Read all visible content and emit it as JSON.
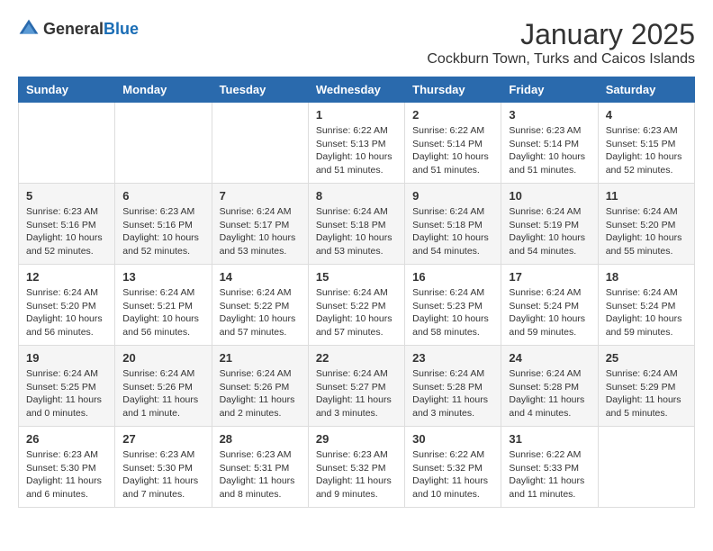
{
  "logo": {
    "general": "General",
    "blue": "Blue"
  },
  "title": "January 2025",
  "subtitle": "Cockburn Town, Turks and Caicos Islands",
  "weekdays": [
    "Sunday",
    "Monday",
    "Tuesday",
    "Wednesday",
    "Thursday",
    "Friday",
    "Saturday"
  ],
  "weeks": [
    [
      {
        "day": "",
        "sunrise": "",
        "sunset": "",
        "daylight": ""
      },
      {
        "day": "",
        "sunrise": "",
        "sunset": "",
        "daylight": ""
      },
      {
        "day": "",
        "sunrise": "",
        "sunset": "",
        "daylight": ""
      },
      {
        "day": "1",
        "sunrise": "Sunrise: 6:22 AM",
        "sunset": "Sunset: 5:13 PM",
        "daylight": "Daylight: 10 hours and 51 minutes."
      },
      {
        "day": "2",
        "sunrise": "Sunrise: 6:22 AM",
        "sunset": "Sunset: 5:14 PM",
        "daylight": "Daylight: 10 hours and 51 minutes."
      },
      {
        "day": "3",
        "sunrise": "Sunrise: 6:23 AM",
        "sunset": "Sunset: 5:14 PM",
        "daylight": "Daylight: 10 hours and 51 minutes."
      },
      {
        "day": "4",
        "sunrise": "Sunrise: 6:23 AM",
        "sunset": "Sunset: 5:15 PM",
        "daylight": "Daylight: 10 hours and 52 minutes."
      }
    ],
    [
      {
        "day": "5",
        "sunrise": "Sunrise: 6:23 AM",
        "sunset": "Sunset: 5:16 PM",
        "daylight": "Daylight: 10 hours and 52 minutes."
      },
      {
        "day": "6",
        "sunrise": "Sunrise: 6:23 AM",
        "sunset": "Sunset: 5:16 PM",
        "daylight": "Daylight: 10 hours and 52 minutes."
      },
      {
        "day": "7",
        "sunrise": "Sunrise: 6:24 AM",
        "sunset": "Sunset: 5:17 PM",
        "daylight": "Daylight: 10 hours and 53 minutes."
      },
      {
        "day": "8",
        "sunrise": "Sunrise: 6:24 AM",
        "sunset": "Sunset: 5:18 PM",
        "daylight": "Daylight: 10 hours and 53 minutes."
      },
      {
        "day": "9",
        "sunrise": "Sunrise: 6:24 AM",
        "sunset": "Sunset: 5:18 PM",
        "daylight": "Daylight: 10 hours and 54 minutes."
      },
      {
        "day": "10",
        "sunrise": "Sunrise: 6:24 AM",
        "sunset": "Sunset: 5:19 PM",
        "daylight": "Daylight: 10 hours and 54 minutes."
      },
      {
        "day": "11",
        "sunrise": "Sunrise: 6:24 AM",
        "sunset": "Sunset: 5:20 PM",
        "daylight": "Daylight: 10 hours and 55 minutes."
      }
    ],
    [
      {
        "day": "12",
        "sunrise": "Sunrise: 6:24 AM",
        "sunset": "Sunset: 5:20 PM",
        "daylight": "Daylight: 10 hours and 56 minutes."
      },
      {
        "day": "13",
        "sunrise": "Sunrise: 6:24 AM",
        "sunset": "Sunset: 5:21 PM",
        "daylight": "Daylight: 10 hours and 56 minutes."
      },
      {
        "day": "14",
        "sunrise": "Sunrise: 6:24 AM",
        "sunset": "Sunset: 5:22 PM",
        "daylight": "Daylight: 10 hours and 57 minutes."
      },
      {
        "day": "15",
        "sunrise": "Sunrise: 6:24 AM",
        "sunset": "Sunset: 5:22 PM",
        "daylight": "Daylight: 10 hours and 57 minutes."
      },
      {
        "day": "16",
        "sunrise": "Sunrise: 6:24 AM",
        "sunset": "Sunset: 5:23 PM",
        "daylight": "Daylight: 10 hours and 58 minutes."
      },
      {
        "day": "17",
        "sunrise": "Sunrise: 6:24 AM",
        "sunset": "Sunset: 5:24 PM",
        "daylight": "Daylight: 10 hours and 59 minutes."
      },
      {
        "day": "18",
        "sunrise": "Sunrise: 6:24 AM",
        "sunset": "Sunset: 5:24 PM",
        "daylight": "Daylight: 10 hours and 59 minutes."
      }
    ],
    [
      {
        "day": "19",
        "sunrise": "Sunrise: 6:24 AM",
        "sunset": "Sunset: 5:25 PM",
        "daylight": "Daylight: 11 hours and 0 minutes."
      },
      {
        "day": "20",
        "sunrise": "Sunrise: 6:24 AM",
        "sunset": "Sunset: 5:26 PM",
        "daylight": "Daylight: 11 hours and 1 minute."
      },
      {
        "day": "21",
        "sunrise": "Sunrise: 6:24 AM",
        "sunset": "Sunset: 5:26 PM",
        "daylight": "Daylight: 11 hours and 2 minutes."
      },
      {
        "day": "22",
        "sunrise": "Sunrise: 6:24 AM",
        "sunset": "Sunset: 5:27 PM",
        "daylight": "Daylight: 11 hours and 3 minutes."
      },
      {
        "day": "23",
        "sunrise": "Sunrise: 6:24 AM",
        "sunset": "Sunset: 5:28 PM",
        "daylight": "Daylight: 11 hours and 3 minutes."
      },
      {
        "day": "24",
        "sunrise": "Sunrise: 6:24 AM",
        "sunset": "Sunset: 5:28 PM",
        "daylight": "Daylight: 11 hours and 4 minutes."
      },
      {
        "day": "25",
        "sunrise": "Sunrise: 6:24 AM",
        "sunset": "Sunset: 5:29 PM",
        "daylight": "Daylight: 11 hours and 5 minutes."
      }
    ],
    [
      {
        "day": "26",
        "sunrise": "Sunrise: 6:23 AM",
        "sunset": "Sunset: 5:30 PM",
        "daylight": "Daylight: 11 hours and 6 minutes."
      },
      {
        "day": "27",
        "sunrise": "Sunrise: 6:23 AM",
        "sunset": "Sunset: 5:30 PM",
        "daylight": "Daylight: 11 hours and 7 minutes."
      },
      {
        "day": "28",
        "sunrise": "Sunrise: 6:23 AM",
        "sunset": "Sunset: 5:31 PM",
        "daylight": "Daylight: 11 hours and 8 minutes."
      },
      {
        "day": "29",
        "sunrise": "Sunrise: 6:23 AM",
        "sunset": "Sunset: 5:32 PM",
        "daylight": "Daylight: 11 hours and 9 minutes."
      },
      {
        "day": "30",
        "sunrise": "Sunrise: 6:22 AM",
        "sunset": "Sunset: 5:32 PM",
        "daylight": "Daylight: 11 hours and 10 minutes."
      },
      {
        "day": "31",
        "sunrise": "Sunrise: 6:22 AM",
        "sunset": "Sunset: 5:33 PM",
        "daylight": "Daylight: 11 hours and 11 minutes."
      },
      {
        "day": "",
        "sunrise": "",
        "sunset": "",
        "daylight": ""
      }
    ]
  ]
}
